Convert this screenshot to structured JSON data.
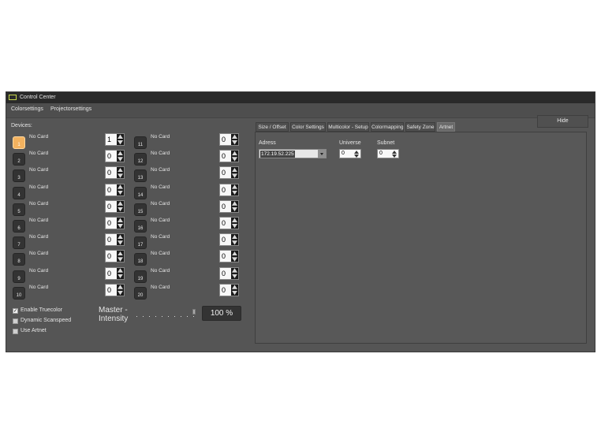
{
  "window": {
    "title": "Control Center"
  },
  "menu": [
    "Colorsettings",
    "Projectorsettings"
  ],
  "devices_label": "Devices:",
  "devices_left": [
    {
      "num": "1",
      "name": "No Card",
      "value": "1",
      "active": true
    },
    {
      "num": "2",
      "name": "No Card",
      "value": "0"
    },
    {
      "num": "3",
      "name": "No Card",
      "value": "0"
    },
    {
      "num": "4",
      "name": "No Card",
      "value": "0"
    },
    {
      "num": "5",
      "name": "No Card",
      "value": "0"
    },
    {
      "num": "6",
      "name": "No Card",
      "value": "0"
    },
    {
      "num": "7",
      "name": "No Card",
      "value": "0"
    },
    {
      "num": "8",
      "name": "No Card",
      "value": "0"
    },
    {
      "num": "9",
      "name": "No Card",
      "value": "0"
    },
    {
      "num": "10",
      "name": "No Card",
      "value": "0"
    }
  ],
  "devices_right": [
    {
      "num": "11",
      "name": "No Card",
      "value": "0"
    },
    {
      "num": "12",
      "name": "No Card",
      "value": "0"
    },
    {
      "num": "13",
      "name": "No Card",
      "value": "0"
    },
    {
      "num": "14",
      "name": "No Card",
      "value": "0"
    },
    {
      "num": "15",
      "name": "No Card",
      "value": "0"
    },
    {
      "num": "16",
      "name": "No Card",
      "value": "0"
    },
    {
      "num": "17",
      "name": "No Card",
      "value": "0"
    },
    {
      "num": "18",
      "name": "No Card",
      "value": "0"
    },
    {
      "num": "19",
      "name": "No Card",
      "value": "0"
    },
    {
      "num": "20",
      "name": "No Card",
      "value": "0"
    }
  ],
  "options": [
    {
      "label": "Enable Truecolor",
      "checked": true
    },
    {
      "label": "Dynamic Scanspeed",
      "checked": false
    },
    {
      "label": "Use Artnet",
      "checked": false
    }
  ],
  "master": {
    "label_line1": "Master -",
    "label_line2": "Intensity",
    "value_text": "100 %",
    "level": 1.0
  },
  "hide_label": "Hide",
  "tabs": [
    {
      "label": "Size / Offset",
      "active": false
    },
    {
      "label": "Color Settings",
      "active": false
    },
    {
      "label": "Multicolor - Setup",
      "active": false
    },
    {
      "label": "Colormapping",
      "active": false
    },
    {
      "label": "Safety Zone",
      "active": false
    },
    {
      "label": "Artnet",
      "active": true
    }
  ],
  "artnet": {
    "address_label": "Adress",
    "address_value": "172.19.52.225",
    "universe_label": "Universe",
    "universe_value": "0",
    "subnet_label": "Subnet",
    "subnet_value": "0"
  },
  "colors": {
    "active_device": "#f3b25f",
    "window_bg": "#555555",
    "titlebar": "#2a2a2a"
  }
}
